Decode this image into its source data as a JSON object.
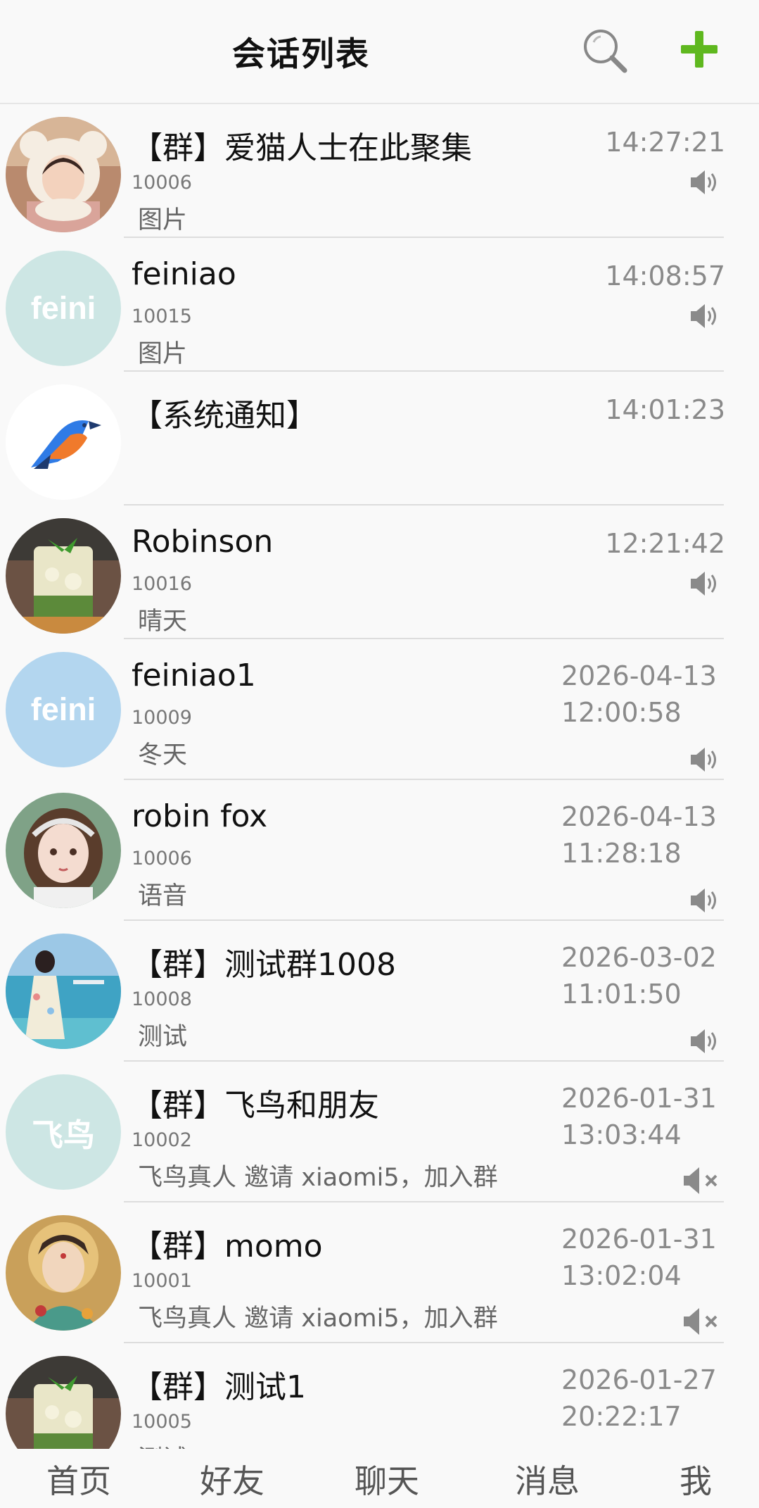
{
  "header": {
    "title": "会话列表",
    "search_icon": "search-icon",
    "add_icon": "plus-icon",
    "add_color": "#5fb81f"
  },
  "conversations": [
    {
      "name": "【群】爱猫人士在此聚集",
      "uid": "10006",
      "message": "图片",
      "date": "",
      "time": "14:27:21",
      "sound": "on",
      "avatar": "photo-girl-bear-hat"
    },
    {
      "name": "feiniao",
      "uid": "10015",
      "message": "图片",
      "date": "",
      "time": "14:08:57",
      "sound": "on",
      "avatar_text": "feini",
      "avatar_color": "#cde6e4"
    },
    {
      "name": "【系统通知】",
      "uid": "",
      "message": "",
      "date": "",
      "time": "14:01:23",
      "sound": "",
      "avatar": "bird-logo"
    },
    {
      "name": "Robinson",
      "uid": "10016",
      "message": "晴天",
      "date": "",
      "time": "12:21:42",
      "sound": "on",
      "avatar": "photo-mojito-drink"
    },
    {
      "name": "feiniao1",
      "uid": "10009",
      "message": "冬天",
      "date": "2026-04-13",
      "time": "12:00:58",
      "sound": "on",
      "avatar_text": "feini",
      "avatar_color": "#b3d6ef"
    },
    {
      "name": "robin fox",
      "uid": "10006",
      "message": "语音",
      "date": "2026-04-13",
      "time": "11:28:18",
      "sound": "on",
      "avatar": "photo-anime-girl"
    },
    {
      "name": "【群】测试群1008",
      "uid": "10008",
      "message": "测试",
      "date": "2026-03-02",
      "time": "11:01:50",
      "sound": "on",
      "avatar": "photo-beach-girl"
    },
    {
      "name": "【群】飞鸟和朋友",
      "uid": "10002",
      "message": "飞鸟真人 邀请 xiaomi5，加入群",
      "date": "2026-01-31",
      "time": "13:03:44",
      "sound": "mute",
      "avatar_text": "飞鸟",
      "avatar_color": "#cde6e4"
    },
    {
      "name": "【群】momo",
      "uid": "10001",
      "message": "飞鸟真人 邀请 xiaomi5，加入群",
      "date": "2026-01-31",
      "time": "13:02:04",
      "sound": "mute",
      "avatar": "photo-goddess-painting"
    },
    {
      "name": "【群】测试1",
      "uid": "10005",
      "message": "测试",
      "date": "2026-01-27",
      "time": "20:22:17",
      "sound": "",
      "avatar": "photo-mojito-drink"
    }
  ],
  "bottom_nav": [
    {
      "label": "首页"
    },
    {
      "label": "好友"
    },
    {
      "label": "聊天"
    },
    {
      "label": "消息"
    },
    {
      "label": "我"
    }
  ]
}
